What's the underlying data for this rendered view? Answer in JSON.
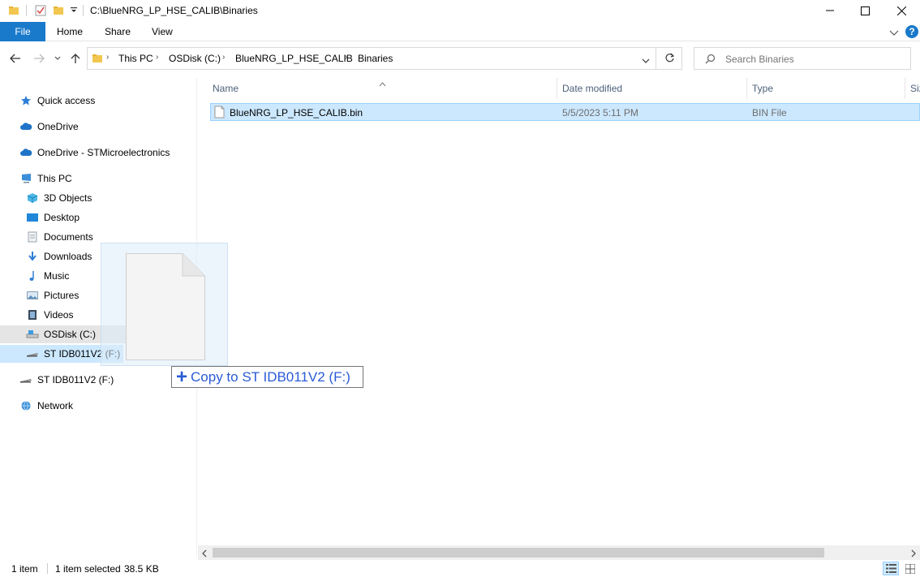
{
  "window": {
    "title": "C:\\BlueNRG_LP_HSE_CALIB\\Binaries"
  },
  "ribbon": {
    "tabs": [
      "File",
      "Home",
      "Share",
      "View"
    ]
  },
  "address": {
    "crumbs": [
      "This PC",
      "OSDisk (C:)",
      "BlueNRG_LP_HSE_CALIB",
      "Binaries"
    ]
  },
  "search": {
    "placeholder": "Search Binaries"
  },
  "sidebar": {
    "items": [
      {
        "label": "Quick access",
        "icon": "star-icon"
      },
      {
        "label": "OneDrive",
        "icon": "cloud-icon"
      },
      {
        "label": "OneDrive - STMicroelectronics",
        "icon": "cloud-icon"
      },
      {
        "label": "This PC",
        "icon": "computer-icon"
      },
      {
        "label": "3D Objects",
        "icon": "cube-icon"
      },
      {
        "label": "Desktop",
        "icon": "desktop-icon"
      },
      {
        "label": "Documents",
        "icon": "documents-icon"
      },
      {
        "label": "Downloads",
        "icon": "download-icon"
      },
      {
        "label": "Music",
        "icon": "music-icon"
      },
      {
        "label": "Pictures",
        "icon": "pictures-icon"
      },
      {
        "label": "Videos",
        "icon": "videos-icon"
      },
      {
        "label": "OSDisk (C:)",
        "icon": "drive-icon"
      },
      {
        "label": "ST IDB011V2 (F:)",
        "icon": "usb-drive-icon"
      },
      {
        "label": "ST IDB011V2 (F:)",
        "icon": "usb-drive-icon"
      },
      {
        "label": "Network",
        "icon": "network-icon"
      }
    ]
  },
  "filelist": {
    "columns": [
      "Name",
      "Date modified",
      "Type",
      "Size"
    ],
    "rows": [
      {
        "name": "BlueNRG_LP_HSE_CALIB.bin",
        "date": "5/5/2023 5:11 PM",
        "type": "BIN File"
      }
    ]
  },
  "drag": {
    "tooltip": "Copy to ST IDB011V2 (F:)"
  },
  "status": {
    "count": "1 item",
    "selected": "1 item selected",
    "size": "38.5 KB"
  },
  "colors": {
    "accent": "#1979ca",
    "selection": "#cce8ff",
    "tooltip_text": "#2a5bd6"
  }
}
